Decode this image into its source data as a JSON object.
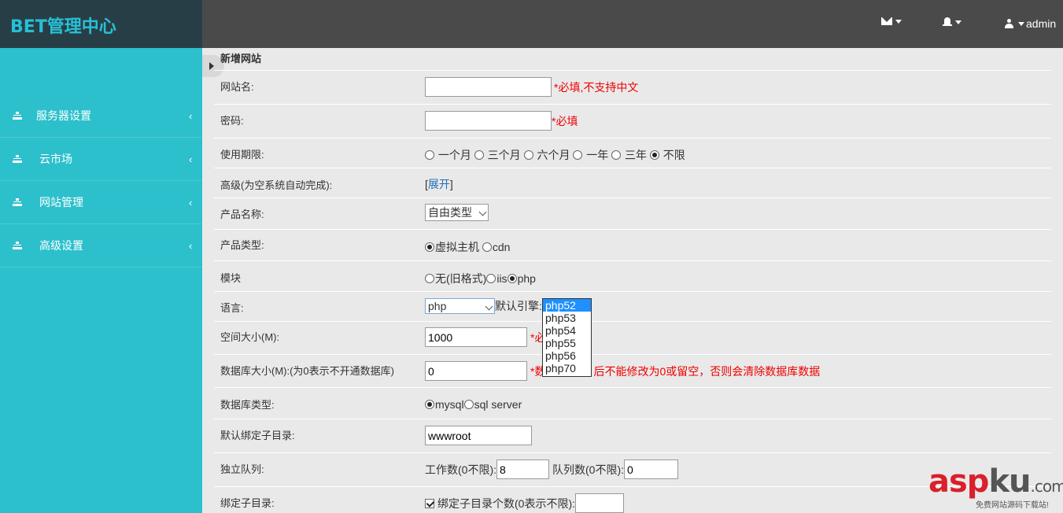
{
  "brand": "BET管理中心",
  "topbar": {
    "user": "admin"
  },
  "sidebar": {
    "items": [
      {
        "label": "服务器设置"
      },
      {
        "label": "云市场"
      },
      {
        "label": "网站管理"
      },
      {
        "label": "高级设置"
      }
    ]
  },
  "form": {
    "title": "新增网站",
    "site_name": {
      "label": "网站名:",
      "value": "",
      "hint": "*必填,不支持中文"
    },
    "password": {
      "label": "密码:",
      "value": "",
      "hint": "*必填"
    },
    "period": {
      "label": "使用期限:",
      "options": [
        "一个月",
        "三个月",
        "六个月",
        "一年",
        "三年",
        "不限"
      ],
      "selected": "不限"
    },
    "advanced": {
      "label": "高级(为空系统自动完成):",
      "bracket_open": "[",
      "link": "展开",
      "bracket_close": "]"
    },
    "product_name": {
      "label": "产品名称:",
      "value": "自由类型"
    },
    "product_type": {
      "label": "产品类型:",
      "options": [
        "虚拟主机",
        "cdn"
      ],
      "selected": "虚拟主机"
    },
    "module": {
      "label": "模块",
      "options": [
        "无(旧格式)",
        "iis",
        "php"
      ],
      "selected": "php"
    },
    "language": {
      "label": "语言:",
      "value": "php",
      "engine_label": "默认引擎:",
      "engine_options": [
        "php52",
        "php53",
        "php54",
        "php55",
        "php56",
        "php70"
      ],
      "engine_selected": "php52"
    },
    "space": {
      "label": "空间大小(M):",
      "value": "1000",
      "hint": "*必"
    },
    "db_size": {
      "label": "数据库大小(M):(为0表示不开通数据库)",
      "value": "0",
      "hint_a": "*数",
      "hint_b": "后不能修改为0或留空，否则会清除数据库数据"
    },
    "db_type": {
      "label": "数据库类型:",
      "options": [
        "mysql",
        "sql server"
      ],
      "selected": "mysql"
    },
    "default_dir": {
      "label": "默认绑定子目录:",
      "value": "wwwroot"
    },
    "queue": {
      "label": "独立队列:",
      "workers_label": "工作数(0不限):",
      "workers_value": "8",
      "queue_label": "队列数(0不限):",
      "queue_value": "0"
    },
    "bind_dir": {
      "label": "绑定子目录:",
      "checkbox_label": "绑定子目录个数(0表示不限):",
      "checked": true,
      "value": ""
    }
  },
  "watermark": {
    "text_a": "asp",
    "text_b": "ku",
    "text_c": ".com",
    "sub": "免费网站源码下载站!"
  }
}
